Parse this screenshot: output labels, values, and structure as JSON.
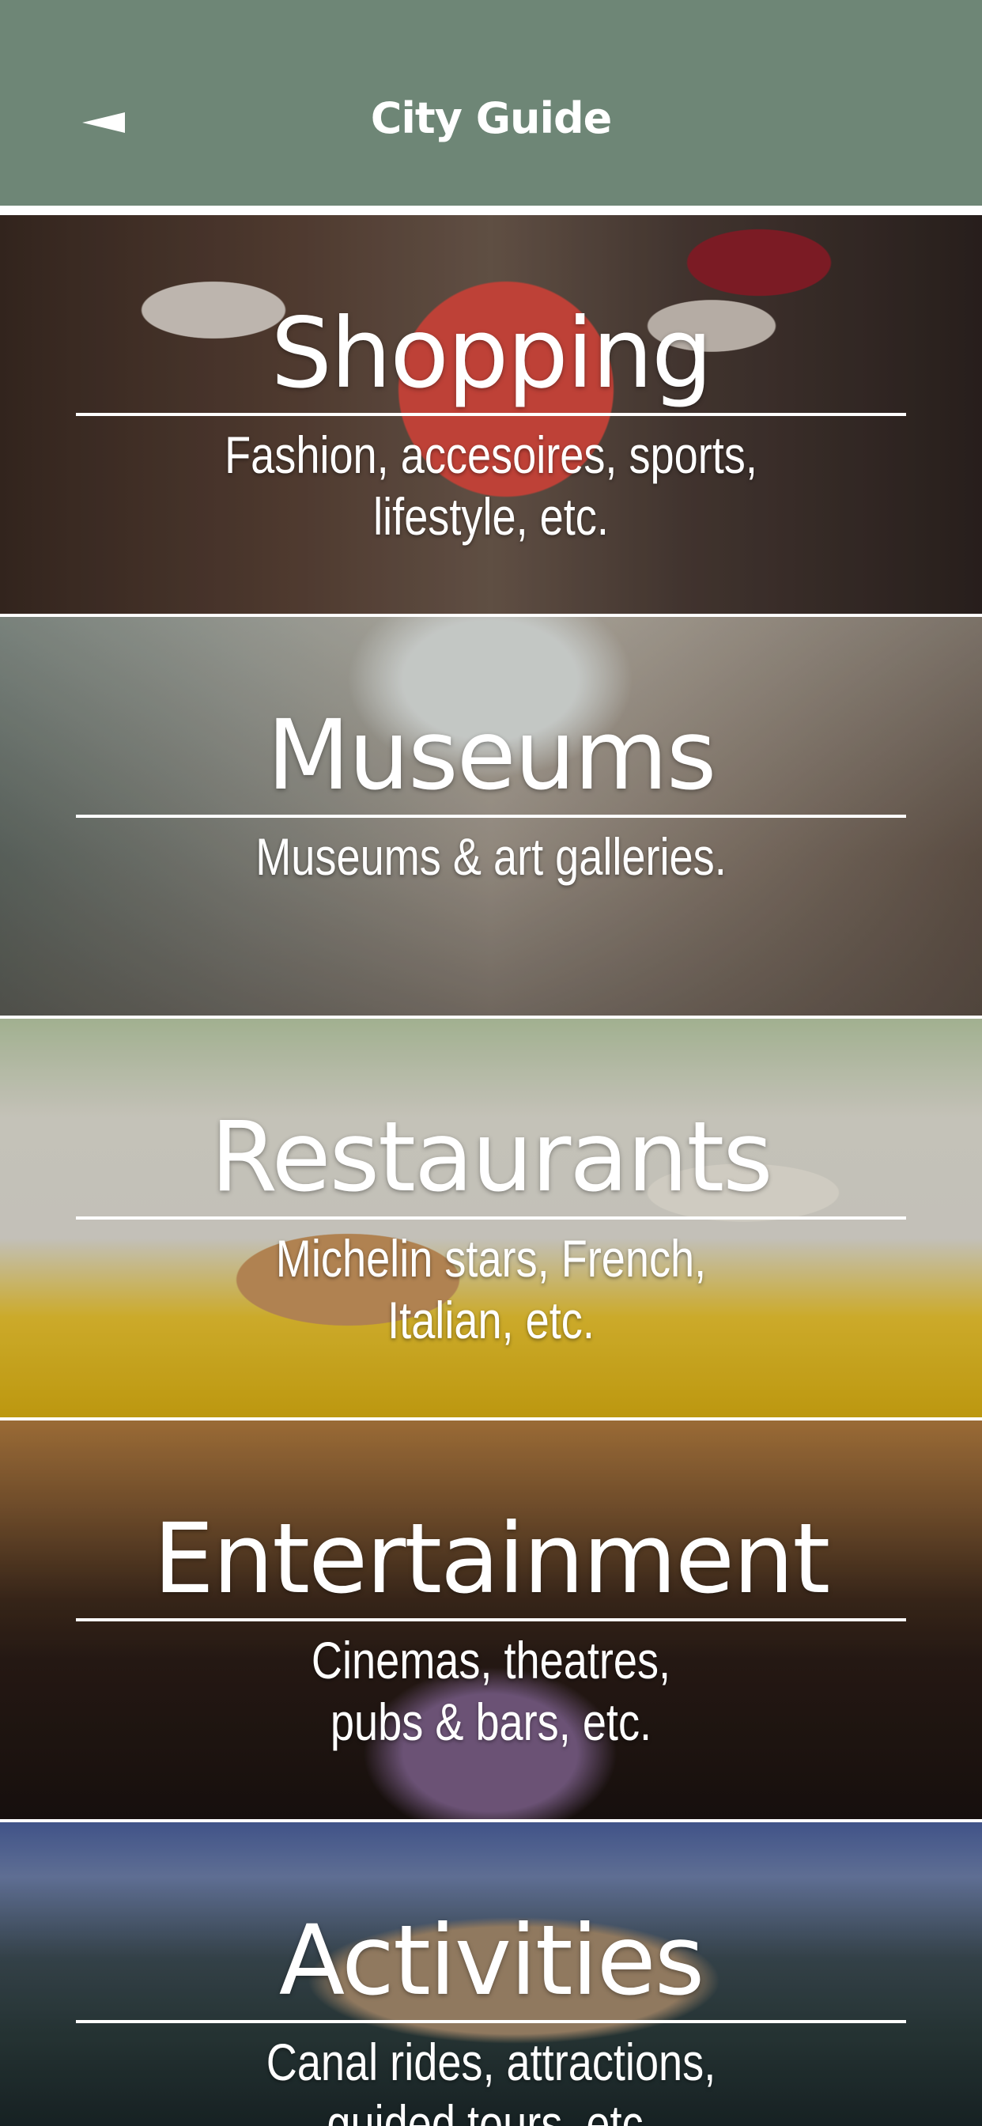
{
  "header": {
    "title": "City Guide",
    "back_icon": "back-arrow-icon",
    "background_color": "#6e8676"
  },
  "categories": [
    {
      "id": "shopping",
      "title": "Shopping",
      "description_line1": "Fashion, accesoires, sports,",
      "description_line2": "lifestyle, etc."
    },
    {
      "id": "museums",
      "title": "Museums",
      "description_line1": "Museums & art galleries.",
      "description_line2": ""
    },
    {
      "id": "restaurants",
      "title": "Restaurants",
      "description_line1": "Michelin stars, French,",
      "description_line2": "Italian, etc."
    },
    {
      "id": "entertainment",
      "title": "Entertainment",
      "description_line1": "Cinemas, theatres,",
      "description_line2": "pubs & bars, etc."
    },
    {
      "id": "activities",
      "title": "Activities",
      "description_line1": "Canal rides, attractions,",
      "description_line2": "guided tours, etc."
    }
  ]
}
